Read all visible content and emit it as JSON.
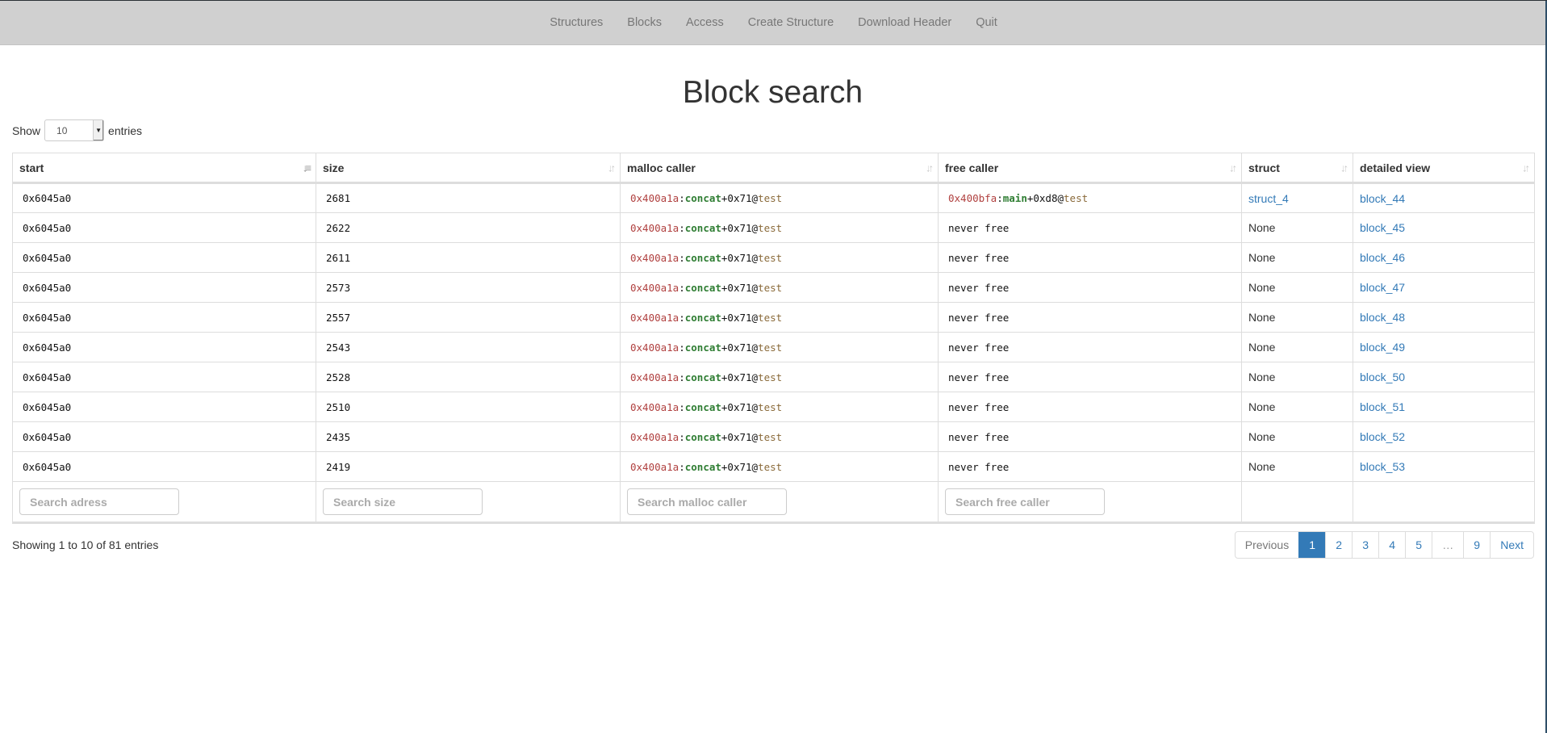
{
  "nav": {
    "items": [
      "Structures",
      "Blocks",
      "Access",
      "Create Structure",
      "Download Header",
      "Quit"
    ]
  },
  "page": {
    "title": "Block search"
  },
  "length_menu": {
    "show_label": "Show",
    "value": "10",
    "entries_label": "entries"
  },
  "table": {
    "columns": [
      {
        "label": "start",
        "sort": "ascending"
      },
      {
        "label": "size",
        "sort": "both"
      },
      {
        "label": "malloc caller",
        "sort": "both"
      },
      {
        "label": "free caller",
        "sort": "both"
      },
      {
        "label": "struct",
        "sort": "both"
      },
      {
        "label": "detailed view",
        "sort": "both"
      }
    ],
    "rows": [
      {
        "start": "0x6045a0",
        "size": "2681",
        "malloc": {
          "addr": "0x400a1a",
          "fn": "concat",
          "off": "+0x71",
          "mod": "test"
        },
        "free": {
          "addr": "0x400bfa",
          "fn": "main",
          "off": "+0xd8",
          "mod": "test"
        },
        "free_text": "",
        "struct": "struct_4",
        "struct_link": true,
        "detail": "block_44"
      },
      {
        "start": "0x6045a0",
        "size": "2622",
        "malloc": {
          "addr": "0x400a1a",
          "fn": "concat",
          "off": "+0x71",
          "mod": "test"
        },
        "free": null,
        "free_text": "never free",
        "struct": "None",
        "struct_link": false,
        "detail": "block_45"
      },
      {
        "start": "0x6045a0",
        "size": "2611",
        "malloc": {
          "addr": "0x400a1a",
          "fn": "concat",
          "off": "+0x71",
          "mod": "test"
        },
        "free": null,
        "free_text": "never free",
        "struct": "None",
        "struct_link": false,
        "detail": "block_46"
      },
      {
        "start": "0x6045a0",
        "size": "2573",
        "malloc": {
          "addr": "0x400a1a",
          "fn": "concat",
          "off": "+0x71",
          "mod": "test"
        },
        "free": null,
        "free_text": "never free",
        "struct": "None",
        "struct_link": false,
        "detail": "block_47"
      },
      {
        "start": "0x6045a0",
        "size": "2557",
        "malloc": {
          "addr": "0x400a1a",
          "fn": "concat",
          "off": "+0x71",
          "mod": "test"
        },
        "free": null,
        "free_text": "never free",
        "struct": "None",
        "struct_link": false,
        "detail": "block_48"
      },
      {
        "start": "0x6045a0",
        "size": "2543",
        "malloc": {
          "addr": "0x400a1a",
          "fn": "concat",
          "off": "+0x71",
          "mod": "test"
        },
        "free": null,
        "free_text": "never free",
        "struct": "None",
        "struct_link": false,
        "detail": "block_49"
      },
      {
        "start": "0x6045a0",
        "size": "2528",
        "malloc": {
          "addr": "0x400a1a",
          "fn": "concat",
          "off": "+0x71",
          "mod": "test"
        },
        "free": null,
        "free_text": "never free",
        "struct": "None",
        "struct_link": false,
        "detail": "block_50"
      },
      {
        "start": "0x6045a0",
        "size": "2510",
        "malloc": {
          "addr": "0x400a1a",
          "fn": "concat",
          "off": "+0x71",
          "mod": "test"
        },
        "free": null,
        "free_text": "never free",
        "struct": "None",
        "struct_link": false,
        "detail": "block_51"
      },
      {
        "start": "0x6045a0",
        "size": "2435",
        "malloc": {
          "addr": "0x400a1a",
          "fn": "concat",
          "off": "+0x71",
          "mod": "test"
        },
        "free": null,
        "free_text": "never free",
        "struct": "None",
        "struct_link": false,
        "detail": "block_52"
      },
      {
        "start": "0x6045a0",
        "size": "2419",
        "malloc": {
          "addr": "0x400a1a",
          "fn": "concat",
          "off": "+0x71",
          "mod": "test"
        },
        "free": null,
        "free_text": "never free",
        "struct": "None",
        "struct_link": false,
        "detail": "block_53"
      }
    ],
    "search_placeholders": {
      "start": "Search adress",
      "size": "Search size",
      "malloc": "Search malloc caller",
      "free": "Search free caller"
    }
  },
  "info": "Showing 1 to 10 of 81 entries",
  "pagination": {
    "previous": "Previous",
    "pages": [
      "1",
      "2",
      "3",
      "4",
      "5",
      "…",
      "9"
    ],
    "current": "1",
    "next": "Next"
  },
  "colors": {
    "navbar_bg": "#d0d0d0",
    "link": "#337ab7",
    "address": "#b0403f",
    "function": "#2e7d32",
    "module": "#8a6a3a"
  }
}
